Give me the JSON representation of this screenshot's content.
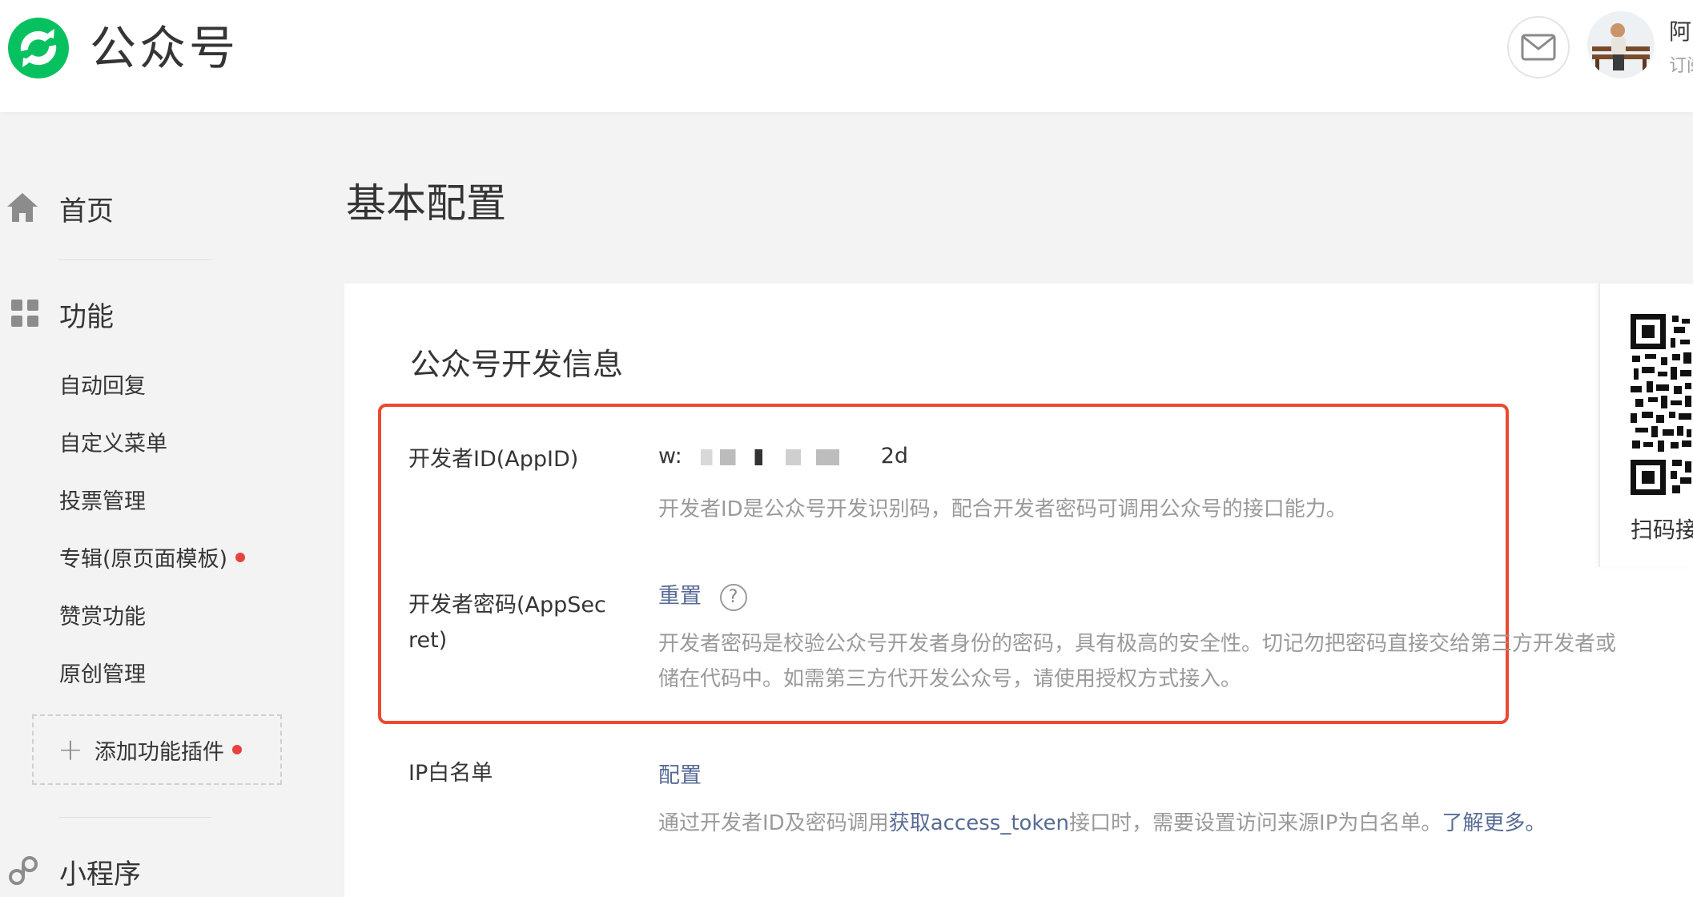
{
  "header": {
    "app_name": "公众号",
    "account_name": "阿",
    "account_type": "订阅",
    "icons": {
      "logo": "wechat-mp-logo-icon",
      "mail": "mail-icon",
      "avatar": "avatar"
    },
    "colors": {
      "brand": "#07c160"
    }
  },
  "sidebar": {
    "home": {
      "label": "首页",
      "icon": "home-icon"
    },
    "features": {
      "label": "功能",
      "icon": "grid-icon",
      "items": [
        {
          "label": "自动回复"
        },
        {
          "label": "自定义菜单"
        },
        {
          "label": "投票管理"
        },
        {
          "label": "专辑(原页面模板)",
          "badge": true
        },
        {
          "label": "赞赏功能"
        },
        {
          "label": "原创管理"
        }
      ],
      "add_plugin": {
        "label": "添加功能插件",
        "badge": true
      }
    },
    "mini_program": {
      "label": "小程序",
      "icon": "link-icon"
    }
  },
  "main": {
    "page_title": "基本配置",
    "section_title": "公众号开发信息",
    "app_id": {
      "label": "开发者ID(AppID)",
      "value_prefix": "w:",
      "value_suffix": "2d",
      "desc": "开发者ID是公众号开发识别码，配合开发者密码可调用公众号的接口能力。"
    },
    "app_secret": {
      "label_line1": "开发者密码(AppSec",
      "label_line2": "ret)",
      "action": "重置",
      "help_icon": "question-circle-icon",
      "desc_line1": "开发者密码是校验公众号开发者身份的密码，具有极高的安全性。切记勿把密码直接交给第三方开发者或",
      "desc_line2": "储在代码中。如需第三方代开发公众号，请使用授权方式接入。"
    },
    "ip_whitelist": {
      "label": "IP白名单",
      "action": "配置",
      "desc_before": "通过开发者ID及密码调用",
      "desc_link": "获取access_token",
      "desc_middle": "接口时，需要设置访问来源IP为白名单。",
      "desc_learn_more": "了解更多。"
    }
  },
  "qr_panel": {
    "text": "扫码接",
    "icon": "qr-code-icon"
  },
  "highlight_color": "#ea4a30",
  "link_color": "#576b95"
}
